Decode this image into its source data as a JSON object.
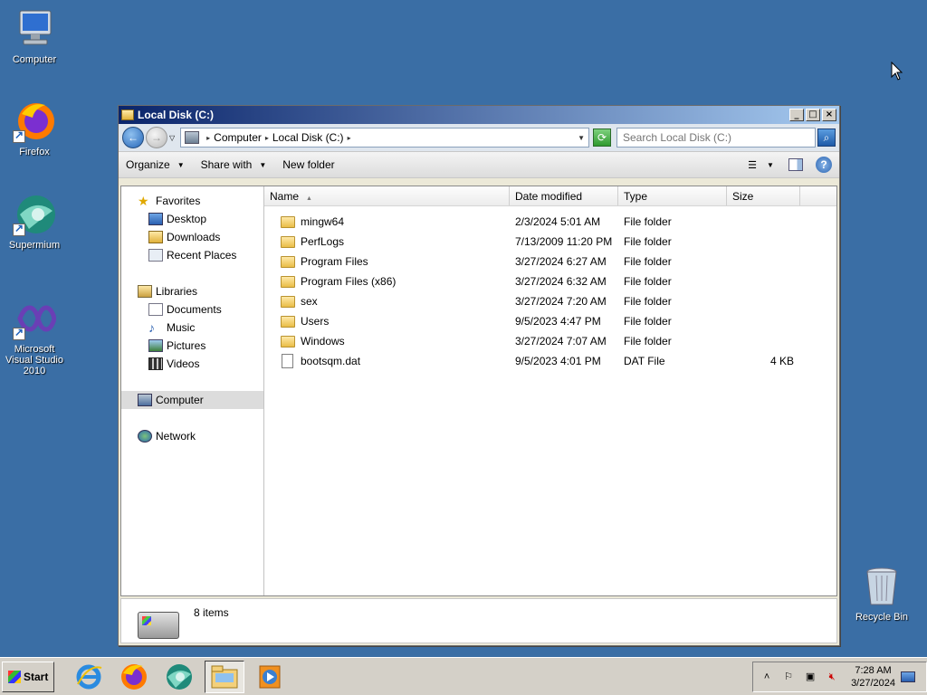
{
  "desktop": {
    "icons": [
      {
        "label": "Computer",
        "icon": "computer-icon"
      },
      {
        "label": "Firefox",
        "icon": "firefox-icon"
      },
      {
        "label": "Supermium",
        "icon": "supermium-icon"
      },
      {
        "label": "Microsoft Visual Studio 2010",
        "icon": "visual-studio-icon"
      },
      {
        "label": "Recycle Bin",
        "icon": "recycle-bin-icon"
      }
    ]
  },
  "window": {
    "title": "Local Disk (C:)",
    "address": {
      "segments": [
        "Computer",
        "Local Disk (C:)"
      ]
    },
    "search_placeholder": "Search Local Disk (C:)",
    "commands": {
      "organize": "Organize",
      "share_with": "Share with",
      "new_folder": "New folder"
    },
    "nav": {
      "favorites": "Favorites",
      "desktop": "Desktop",
      "downloads": "Downloads",
      "recent_places": "Recent Places",
      "libraries": "Libraries",
      "documents": "Documents",
      "music": "Music",
      "pictures": "Pictures",
      "videos": "Videos",
      "computer": "Computer",
      "network": "Network"
    },
    "columns": {
      "name": "Name",
      "date_modified": "Date modified",
      "type": "Type",
      "size": "Size"
    },
    "files": [
      {
        "name": "mingw64",
        "date": "2/3/2024 5:01 AM",
        "type": "File folder",
        "size": "",
        "kind": "folder"
      },
      {
        "name": "PerfLogs",
        "date": "7/13/2009 11:20 PM",
        "type": "File folder",
        "size": "",
        "kind": "folder"
      },
      {
        "name": "Program Files",
        "date": "3/27/2024 6:27 AM",
        "type": "File folder",
        "size": "",
        "kind": "folder"
      },
      {
        "name": "Program Files (x86)",
        "date": "3/27/2024 6:32 AM",
        "type": "File folder",
        "size": "",
        "kind": "folder"
      },
      {
        "name": "sex",
        "date": "3/27/2024 7:20 AM",
        "type": "File folder",
        "size": "",
        "kind": "folder"
      },
      {
        "name": "Users",
        "date": "9/5/2023 4:47 PM",
        "type": "File folder",
        "size": "",
        "kind": "folder"
      },
      {
        "name": "Windows",
        "date": "3/27/2024 7:07 AM",
        "type": "File folder",
        "size": "",
        "kind": "folder"
      },
      {
        "name": "bootsqm.dat",
        "date": "9/5/2023 4:01 PM",
        "type": "DAT File",
        "size": "4 KB",
        "kind": "file"
      }
    ],
    "status": {
      "count": "8 items"
    }
  },
  "taskbar": {
    "start_label": "Start",
    "clock": {
      "time": "7:28 AM",
      "date": "3/27/2024"
    }
  }
}
